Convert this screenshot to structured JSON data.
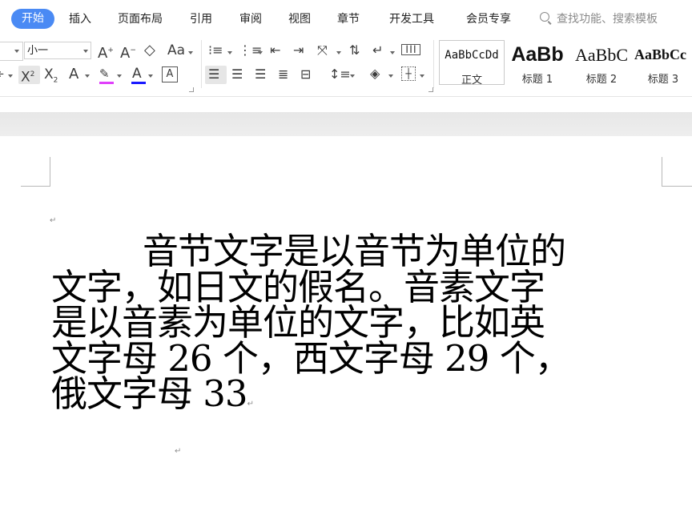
{
  "menu": {
    "tabs": [
      "开始",
      "插入",
      "页面布局",
      "引用",
      "审阅",
      "视图",
      "章节",
      "开发工具",
      "会员专享"
    ],
    "search_placeholder": "查找功能、搜索模板"
  },
  "ribbon": {
    "font_size": "小一",
    "styles": [
      {
        "sample": "AaBbCcDd",
        "label": "正文"
      },
      {
        "sample": "AaBb",
        "label": "标题 1"
      },
      {
        "sample": "AaBbC",
        "label": "标题 2"
      },
      {
        "sample": "AaBbCc",
        "label": "标题 3"
      }
    ],
    "icons": [
      "grow-font",
      "shrink-font",
      "clear-format",
      "change-case",
      "superscript",
      "subscript",
      "text-effect",
      "highlight",
      "font-color",
      "char-border",
      "bullets",
      "numbering",
      "decrease-indent",
      "increase-indent",
      "chinese-layout",
      "sort",
      "show-marks",
      "ruler",
      "align-left",
      "align-center",
      "align-right",
      "justify",
      "distribute",
      "line-spacing",
      "shading",
      "borders"
    ],
    "colors": {
      "accent": "#4a8af4",
      "highlight": "#e040fb",
      "font_color": "#1a1aff"
    }
  },
  "document": {
    "lines": [
      "音节文字是以音节为单位的",
      "文字，如日文的假名。音素文字",
      "是以音素为单位的文字，比如英",
      "文字母 26 个，西文字母 29 个，",
      "俄文字母 33"
    ],
    "para_mark": "↵"
  }
}
